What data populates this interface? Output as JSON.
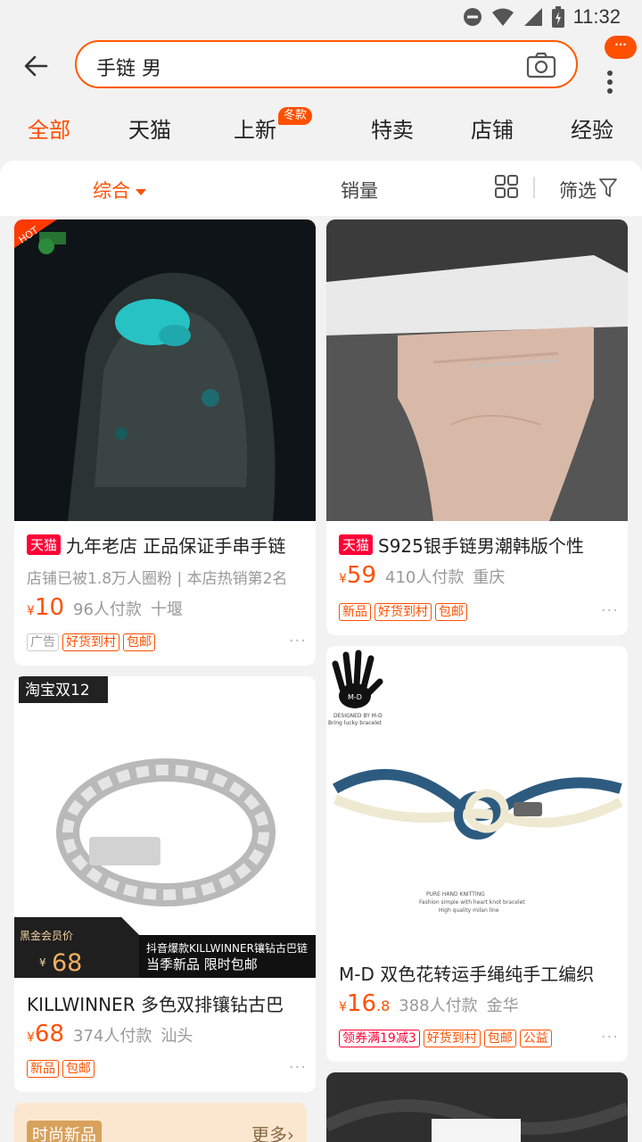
{
  "status": {
    "time": "11:32"
  },
  "search": {
    "query": "手链 男",
    "more_badge": "···"
  },
  "tabs": [
    {
      "label": "全部"
    },
    {
      "label": "天猫"
    },
    {
      "label": "上新",
      "badge": "冬款"
    },
    {
      "label": "特卖"
    },
    {
      "label": "店铺"
    },
    {
      "label": "经验"
    }
  ],
  "sort": {
    "comprehensive": "综合",
    "sales": "销量",
    "filter": "筛选"
  },
  "products": [
    {
      "badge": "天猫",
      "title": "九年老店 正品保证手串手链",
      "subtitle": "店铺已被1.8万人圈粉 | 本店热销第2名",
      "currency": "¥",
      "price": "10",
      "sold": "96人付款",
      "location": "十堰",
      "tags": [
        "广告",
        "好货到村",
        "包邮"
      ],
      "hot_label": "HOT",
      "more": "···"
    },
    {
      "badge": "天猫",
      "title": "S925银手链男潮韩版个性",
      "currency": "¥",
      "price": "59",
      "sold": "410人付款",
      "location": "重庆",
      "tags": [
        "新品",
        "好货到村",
        "包邮"
      ],
      "more": "···"
    },
    {
      "title": "KILLWINNER 多色双排镶钻古巴",
      "currency": "¥",
      "price": "68",
      "sold": "374人付款",
      "location": "汕头",
      "tags": [
        "新品",
        "包邮"
      ],
      "promo_corner": "淘宝双12",
      "member_label": "黑金会员价",
      "member_price": "68",
      "promo_line1": "抖音爆款KILLWINNER镶钻古巴链",
      "promo_line2": "当季新品 限时包邮",
      "more": "···"
    },
    {
      "title": "M-D 双色花转运手绳纯手工编织",
      "currency": "¥",
      "price": "16",
      "price_decimal": ".8",
      "sold": "388人付款",
      "location": "金华",
      "tags": [
        "领券满19减3",
        "好货到村",
        "包邮",
        "公益"
      ],
      "image_text": [
        "M-D",
        "DESIGNED BY M-D",
        "Bring lucky bracelet",
        "PURE HAND KNITTING",
        "Fashion simple with heart knot bracelet",
        "High quality milan line"
      ],
      "more": "···"
    }
  ],
  "bottom_banner": {
    "label": "时尚新品",
    "more": "更多"
  },
  "colors": {
    "accent": "#ff5000",
    "tmall": "#ff0036",
    "background": "#f2f2f2"
  }
}
